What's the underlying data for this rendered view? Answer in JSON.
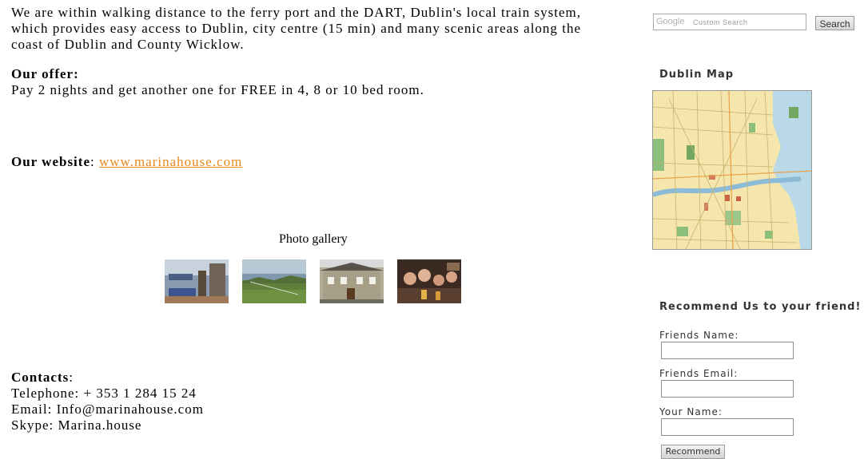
{
  "main": {
    "intro": "We are within walking distance to the ferry port and the DART, Dublin's local train system, which provides easy access to Dublin, city centre (15 min) and many scenic areas along the coast of Dublin and County Wicklow.",
    "offer_heading": "Our offer:",
    "offer_text": "Pay 2 nights and get another one for FREE in 4, 8 or 10 bed room.",
    "website_heading": "Our website",
    "website_sep": ":",
    "website_link": "www.marinahouse.com",
    "gallery_title": "Photo gallery",
    "contacts_heading": "Contacts",
    "contacts_sep": ":",
    "telephone": "Telephone: + 353 1 284 15 24",
    "email": "Email: Info@marinahouse.com",
    "skype": "Skype: Marina.house"
  },
  "sidebar": {
    "search_logo": "Google",
    "search_placeholder": "Custom Search",
    "search_button": "Search",
    "map_title": "Dublin Map",
    "recommend_title": "Recommend Us to your friend!",
    "friends_name_label": "Friends Name:",
    "friends_email_label": "Friends Email:",
    "your_name_label": "Your Name:",
    "recommend_button": "Recommend"
  }
}
